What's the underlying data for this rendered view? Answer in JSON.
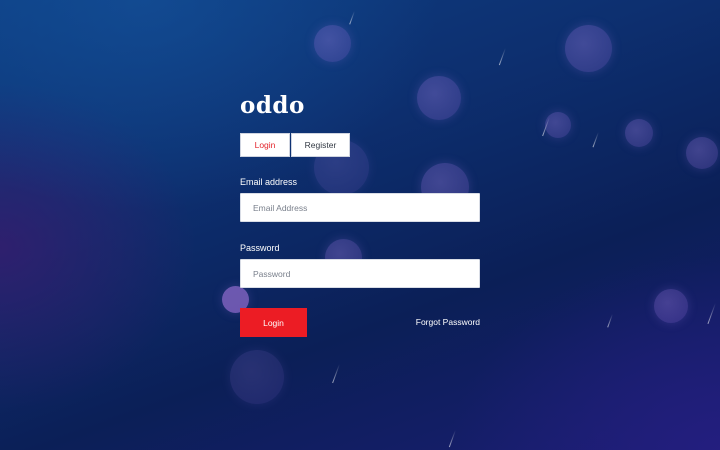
{
  "brand": {
    "name": "oddo"
  },
  "tabs": [
    {
      "label": "Login",
      "active": true
    },
    {
      "label": "Register",
      "active": false
    }
  ],
  "form": {
    "email_label": "Email address",
    "email_placeholder": "Email Address",
    "email_value": "",
    "password_label": "Password",
    "password_placeholder": "Password",
    "password_value": "",
    "submit_label": "Login",
    "forgot_label": "Forgot Password"
  },
  "colors": {
    "accent": "#ec1c24",
    "background": "#0d2f6f",
    "bubble": "#8a6bd1"
  }
}
